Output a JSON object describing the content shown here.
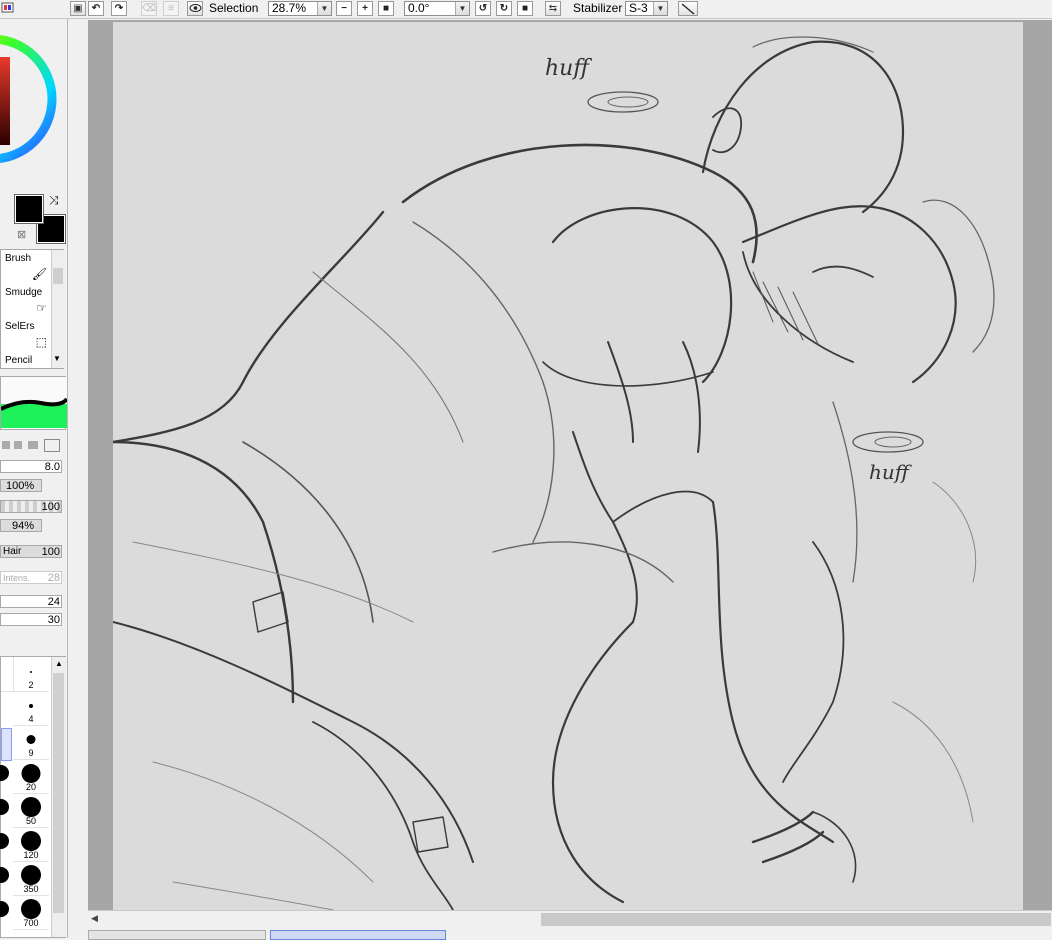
{
  "toolbar": {
    "view_mode": "Selection",
    "zoom": "28.7%",
    "rotation": "0.0°",
    "stabilizer_label": "Stabilizer",
    "stabilizer_value": "S-3"
  },
  "tools": {
    "items": [
      {
        "label": "Brush"
      },
      {
        "label": "Smudge"
      },
      {
        "label": "SelErs"
      },
      {
        "label": "Pencil"
      }
    ]
  },
  "brush_params": {
    "size": "8.0",
    "density": "100%",
    "blend_value": "100",
    "min_size": "94%",
    "hair_label": "Hair",
    "hair_value": "100",
    "intens_label": "Intens.",
    "intens_value": "28",
    "param_a": "24",
    "param_b": "30"
  },
  "brush_sizes": [
    "2",
    "4",
    "9",
    "20",
    "50",
    "120",
    "350",
    "700"
  ],
  "canvas": {
    "annotation_1": "huff",
    "annotation_2": "huff"
  },
  "colors": {
    "primary": "#000000",
    "secondary": "#000000",
    "brush_preview": "#1ef25a",
    "canvas_bg": "#dbdbdb",
    "canvas_outer": "#a6a6a6"
  }
}
